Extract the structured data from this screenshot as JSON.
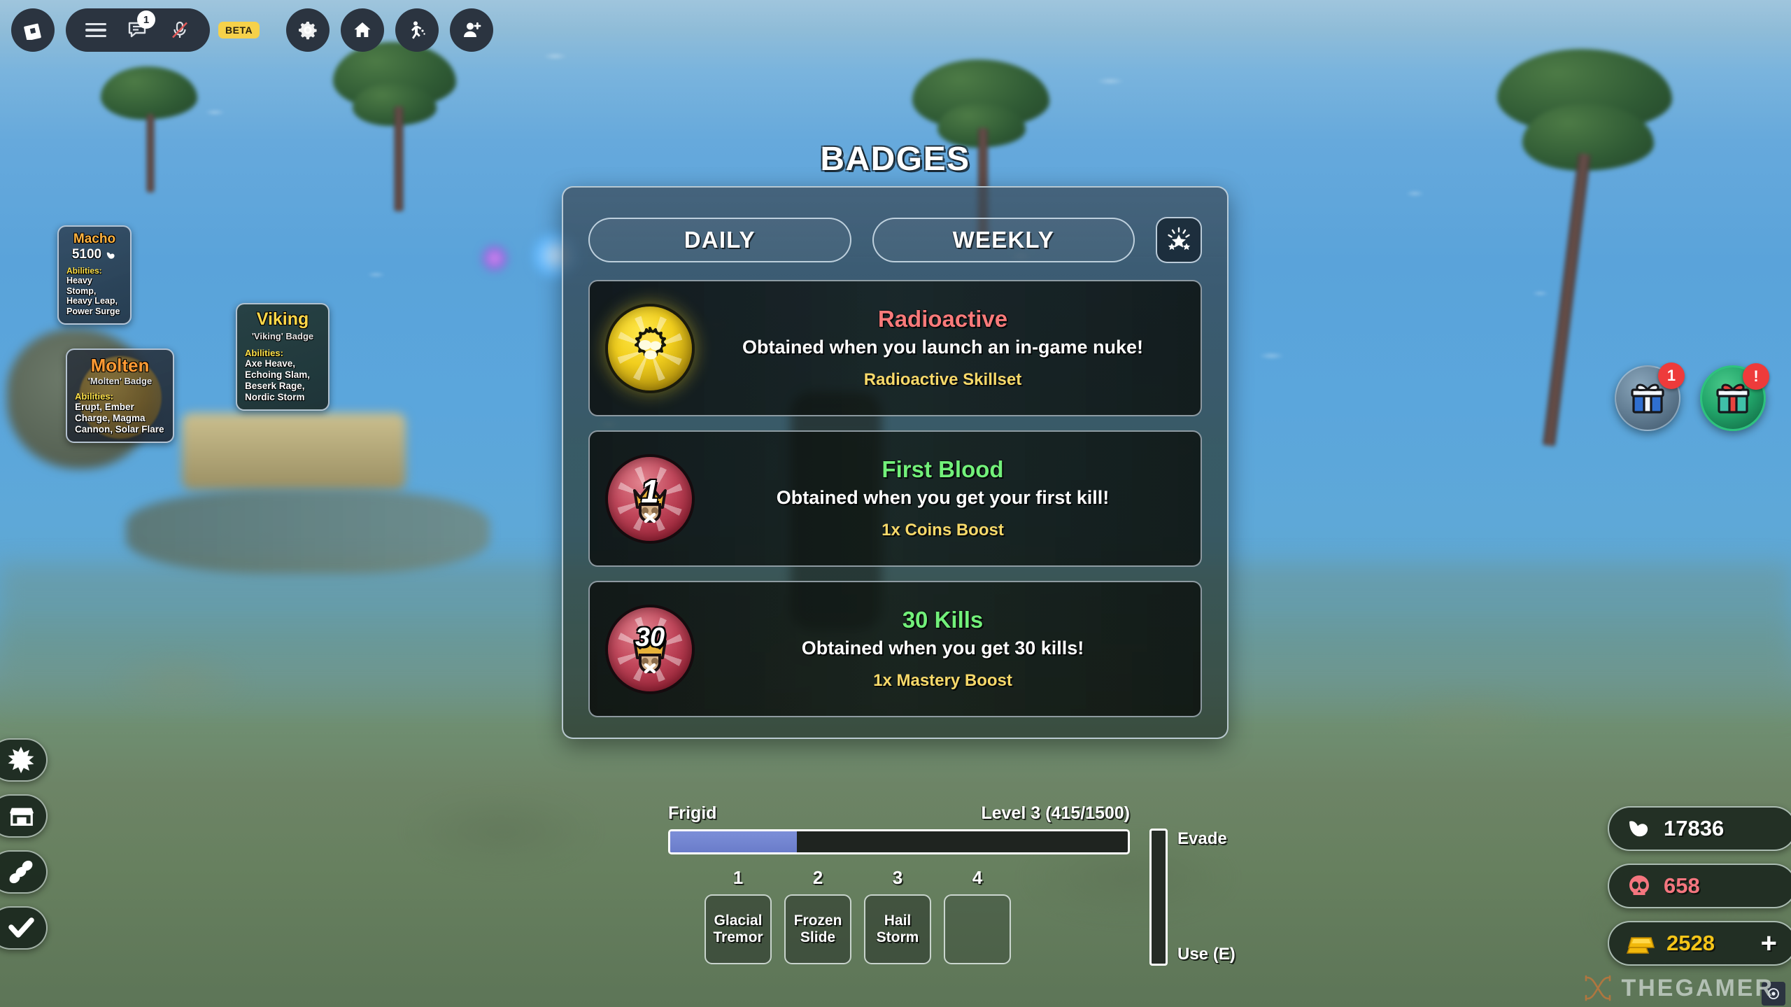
{
  "roblox_topbar": {
    "logo_icon": "roblox-logo-icon",
    "menu_icon": "hamburger-menu-icon",
    "chat_icon": "chat-icon",
    "chat_badge": "1",
    "mic_icon": "microphone-muted-icon",
    "beta_label": "BETA",
    "settings_icon": "gear-icon",
    "home_icon": "home-icon",
    "emote_icon": "emote-dance-icon",
    "friends_icon": "add-friend-icon"
  },
  "nametags": [
    {
      "name": "Macho",
      "score": "5100",
      "score_icon": "muscle-icon",
      "abilities_label": "Abilities:",
      "abilities": "Heavy Stomp, Heavy Leap, Power Surge"
    },
    {
      "name": "Viking",
      "badge": "'Viking' Badge",
      "abilities_label": "Abilities:",
      "abilities": "Axe Heave, Echoing Slam, Beserk Rage, Nordic Storm"
    },
    {
      "name": "Molten",
      "badge": "'Molten' Badge",
      "abilities_label": "Abilities:",
      "abilities": "Erupt, Ember Charge, Magma Cannon, Solar Flare"
    }
  ],
  "left_sidebar": [
    {
      "icon": "star-burst-icon"
    },
    {
      "icon": "shop-store-icon"
    },
    {
      "icon": "bone-icon"
    },
    {
      "icon": "checkmark-icon"
    }
  ],
  "gift_buttons": [
    {
      "icon": "gift-box-blue-icon",
      "notification": "1"
    },
    {
      "icon": "gift-box-red-icon",
      "notification": "!"
    }
  ],
  "badges_panel": {
    "title": "BADGES",
    "tabs": [
      {
        "label": "DAILY",
        "selected": true
      },
      {
        "label": "WEEKLY",
        "selected": false
      }
    ],
    "sparkle_button_icon": "sparkle-stars-icon",
    "badges": [
      {
        "name": "Radioactive",
        "name_color": "#f87a7a",
        "description": "Obtained when you launch an in-game nuke!",
        "reward": "Radioactive Skillset",
        "icon": "radioactive-medal-icon"
      },
      {
        "name": "First Blood",
        "name_color": "#72f07a",
        "description": "Obtained when you get your first kill!",
        "reward": "1x Coins Boost",
        "icon": "first-kill-medal-icon",
        "medal_number": "1"
      },
      {
        "name": "30 Kills",
        "name_color": "#72f07a",
        "description": "Obtained when you get 30 kills!",
        "reward": "1x Mastery Boost",
        "icon": "thirty-kills-medal-icon",
        "medal_number": "30"
      }
    ]
  },
  "xp_hud": {
    "element_name": "Frigid",
    "level_text": "Level 3 (415/1500)",
    "progress_percent": 27.7,
    "fill_color": "#6a7cca"
  },
  "ability_slots": [
    {
      "key": "1",
      "name": "Glacial Tremor"
    },
    {
      "key": "2",
      "name": "Frozen Slide"
    },
    {
      "key": "3",
      "name": "Hail Storm"
    },
    {
      "key": "4",
      "name": ""
    }
  ],
  "evade_hud": {
    "top_label": "Evade",
    "bottom_label": "Use (E)"
  },
  "currencies": [
    {
      "icon": "muscle-strength-icon",
      "value": "17836",
      "color": "#ffffff"
    },
    {
      "icon": "skull-kills-icon",
      "value": "658",
      "color": "#f4767f"
    },
    {
      "icon": "gold-bar-icon",
      "value": "2528",
      "color": "#f5c518",
      "add_button": "+"
    }
  ],
  "watermark": {
    "text": "THEGAMER",
    "logo_icon": "thegamer-logo-icon",
    "cursor_icon": "cursor-icon"
  }
}
